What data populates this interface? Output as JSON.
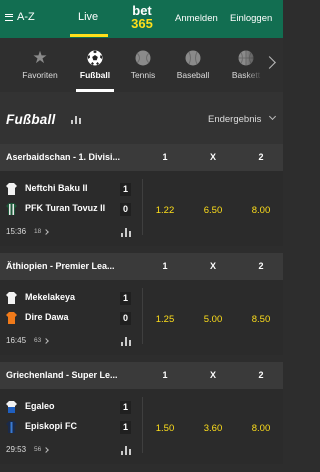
{
  "header": {
    "menu_label": "A-Z",
    "live_label": "Live",
    "logo_line1": "bet",
    "logo_line2": "365",
    "login_label": "Anmelden",
    "register_label": "Einloggen"
  },
  "sports": [
    {
      "label": "Favoriten",
      "icon": "star-icon"
    },
    {
      "label": "Fußball",
      "icon": "soccer-ball-icon",
      "active": true
    },
    {
      "label": "Tennis",
      "icon": "tennis-ball-icon"
    },
    {
      "label": "Baseball",
      "icon": "baseball-icon"
    },
    {
      "label": "Baskett",
      "icon": "basketball-icon"
    }
  ],
  "section": {
    "title": "Fußball",
    "market_label": "Endergebnis"
  },
  "columns": {
    "home": "1",
    "draw": "X",
    "away": "2"
  },
  "competitions": [
    {
      "name": "Aserbaidschan - 1. Divisi...",
      "match": {
        "home": "Neftchi Baku II",
        "away": "PFK Turan Tovuz II",
        "home_score": "1",
        "away_score": "0",
        "time": "15:36",
        "markets_count": "18",
        "odds": [
          "1.22",
          "6.50",
          "8.00"
        ]
      }
    },
    {
      "name": "Äthiopien - Premier Lea...",
      "match": {
        "home": "Mekelakeya",
        "away": "Dire Dawa",
        "home_score": "1",
        "away_score": "0",
        "time": "16:45",
        "markets_count": "63",
        "odds": [
          "1.25",
          "5.00",
          "8.50"
        ]
      }
    },
    {
      "name": "Griechenland - Super Le...",
      "match": {
        "home": "Egaleo",
        "away": "Episkopi FC",
        "home_score": "1",
        "away_score": "1",
        "time": "29:53",
        "markets_count": "56",
        "odds": [
          "1.50",
          "3.60",
          "8.00"
        ]
      }
    }
  ],
  "colors": {
    "brand_green": "#126e51",
    "accent_yellow": "#ffdf1b",
    "background": "#2d2d2d"
  }
}
